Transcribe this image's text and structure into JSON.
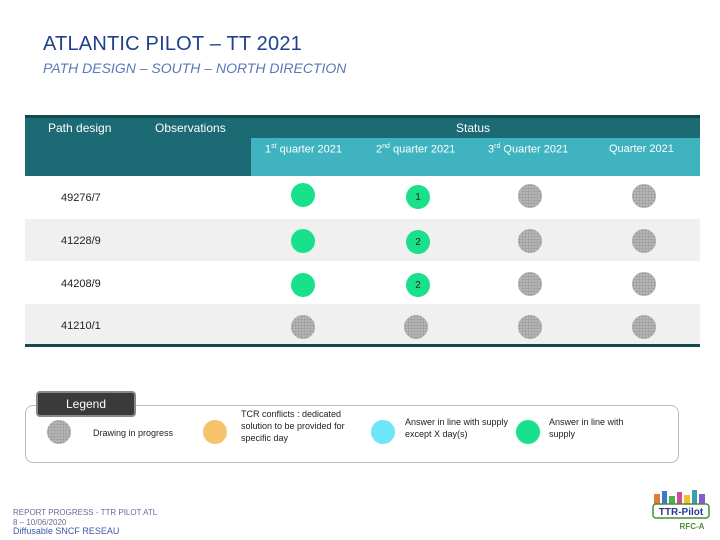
{
  "header": {
    "title": "ATLANTIC PILOT – TT 2021",
    "subtitle": "PATH DESIGN – SOUTH – NORTH DIRECTION"
  },
  "table": {
    "col_path": "Path design",
    "col_obs": "Observations",
    "col_status": "Status",
    "quarters": [
      {
        "num": "1",
        "sup": "st",
        "rest": " quarter 2021"
      },
      {
        "num": "2",
        "sup": "nd",
        "rest": " quarter 2021"
      },
      {
        "num": "3",
        "sup": "rd",
        "rest": " Quarter 2021"
      },
      {
        "num": "",
        "sup": "",
        "rest": "Quarter 2021"
      }
    ],
    "rows": [
      {
        "path": "49276/7",
        "q1": "green",
        "q2": "green",
        "q2_num": "1",
        "q3": "grey",
        "q4": "grey"
      },
      {
        "path": "41228/9",
        "q1": "green",
        "q2": "green",
        "q2_num": "2",
        "q3": "grey",
        "q4": "grey"
      },
      {
        "path": "44208/9",
        "q1": "green",
        "q2": "green",
        "q2_num": "2",
        "q3": "grey",
        "q4": "grey"
      },
      {
        "path": "41210/1",
        "q1": "grey",
        "q2": "grey",
        "q2_num": "",
        "q3": "grey",
        "q4": "grey"
      }
    ]
  },
  "legend": {
    "title": "Legend",
    "items": [
      {
        "color": "grey",
        "text": "Drawing in progress"
      },
      {
        "color": "orange",
        "text": "TCR conflicts : dedicated solution to be provided for specific day"
      },
      {
        "color": "cyan",
        "text": "Answer in line with supply except X day(s)"
      },
      {
        "color": "green",
        "text": "Answer in line with supply"
      }
    ]
  },
  "footer": {
    "line1": "REPORT PROGRESS - TTR PILOT ATL",
    "line2": "8     –  10/06/2020",
    "line3": "Diffusable SNCF RESEAU"
  },
  "logo": {
    "text": "TTR-Pilot",
    "sub": "RFC-A"
  },
  "colors": {
    "header_dark": "#1c6a73",
    "header_light": "#3fb3c0",
    "green": "#19e08a",
    "grey": "#b4b4b4",
    "orange": "#f7c26b",
    "cyan": "#6ee6f7"
  }
}
